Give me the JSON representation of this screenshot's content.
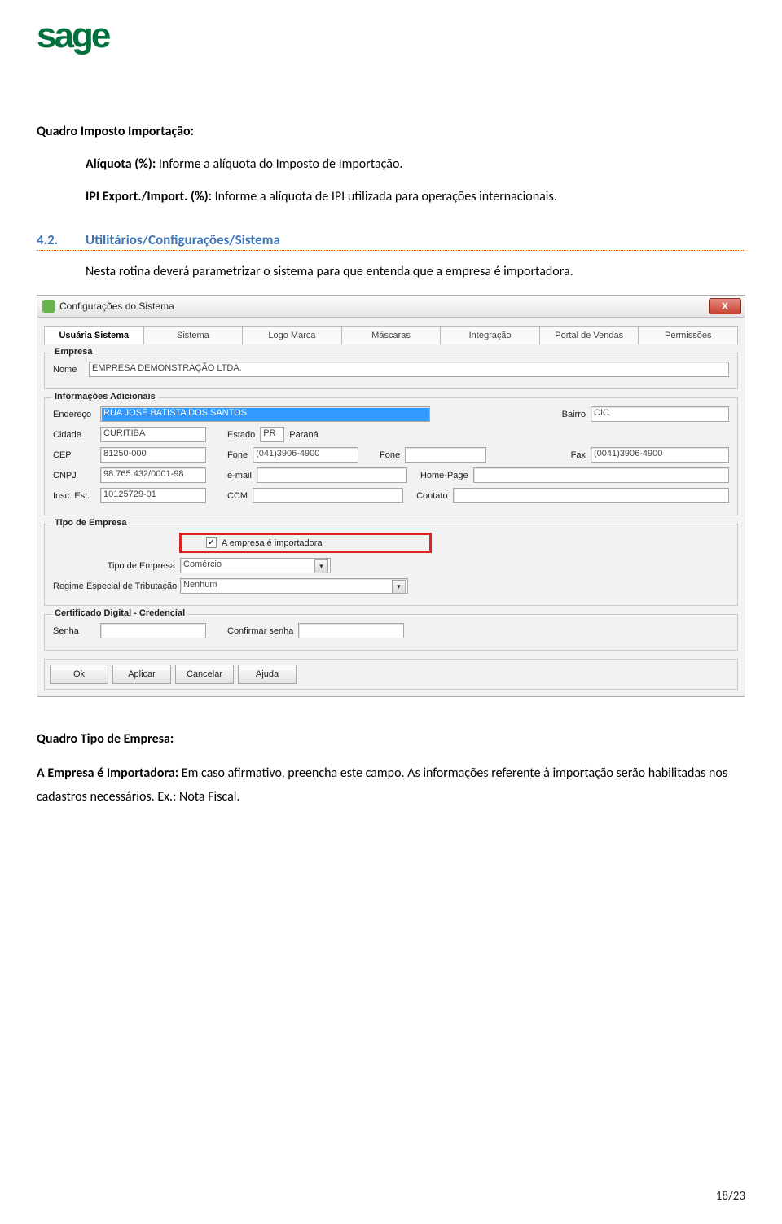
{
  "logo_alt": "sage",
  "doc": {
    "h1_bold": "Quadro Imposto Importação:",
    "p1_bold": "Alíquota (%):",
    "p1_rest": " Informe a alíquota do Imposto de Importação.",
    "p2_bold": "IPI Export./Import. (%):",
    "p2_rest": " Informe a alíquota de IPI utilizada para operações internacionais.",
    "section_num": "4.2.",
    "section_title": "Utilitários/Configurações/Sistema",
    "p3": "Nesta rotina deverá parametrizar o sistema para que entenda que a empresa é importadora.",
    "h2_bold": "Quadro Tipo de Empresa:",
    "p4_bold": "A Empresa é Importadora:",
    "p4_rest": " Em caso afirmativo, preencha este campo. As informações referente à importação serão habilitadas nos cadastros necessários. Ex.: Nota Fiscal."
  },
  "window": {
    "title": "Configurações do Sistema",
    "close_x": "X",
    "tabs": [
      "Usuária Sistema",
      "Sistema",
      "Logo Marca",
      "Máscaras",
      "Integração",
      "Portal de Vendas",
      "Permissões"
    ],
    "empresa": {
      "legend": "Empresa",
      "nome_lbl": "Nome",
      "nome_val": "EMPRESA DEMONSTRAÇÃO LTDA."
    },
    "info": {
      "legend": "Informações Adicionais",
      "endereco_lbl": "Endereço",
      "endereco_val": "RUA JOSÉ BATISTA DOS SANTOS",
      "bairro_lbl": "Bairro",
      "bairro_val": "CIC",
      "cidade_lbl": "Cidade",
      "cidade_val": "CURITIBA",
      "estado_lbl": "Estado",
      "estado_val": "PR",
      "estado_desc": "Paraná",
      "cep_lbl": "CEP",
      "cep_val": "81250-000",
      "fone_lbl": "Fone",
      "fone_val": "(041)3906-4900",
      "fone2_lbl": "Fone",
      "fone2_val": "",
      "fax_lbl": "Fax",
      "fax_val": "(0041)3906-4900",
      "cnpj_lbl": "CNPJ",
      "cnpj_val": "98.765.432/0001-98",
      "email_lbl": "e-mail",
      "email_val": "",
      "homepage_lbl": "Home-Page",
      "homepage_val": "",
      "ie_lbl": "Insc. Est.",
      "ie_val": "10125729-01",
      "ccm_lbl": "CCM",
      "ccm_val": "",
      "contato_lbl": "Contato",
      "contato_val": ""
    },
    "tipo": {
      "legend": "Tipo de Empresa",
      "chk_lbl": "A empresa é importadora",
      "tipo_lbl": "Tipo de Empresa",
      "tipo_val": "Comércio",
      "regime_lbl": "Regime Especial de Tributação",
      "regime_val": "Nenhum"
    },
    "cert": {
      "legend": "Certificado Digital - Credencial",
      "senha_lbl": "Senha",
      "confirm_lbl": "Confirmar senha"
    },
    "buttons": [
      "Ok",
      "Aplicar",
      "Cancelar",
      "Ajuda"
    ]
  },
  "page_num": "18/23"
}
